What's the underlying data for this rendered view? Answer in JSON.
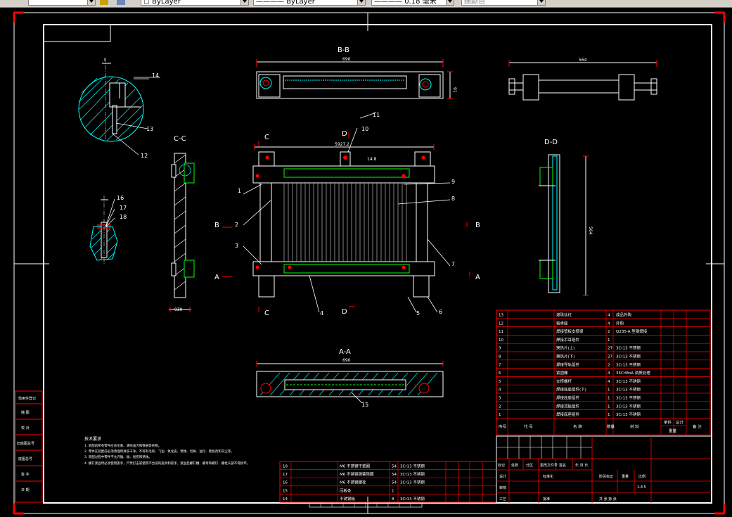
{
  "toolbar": {
    "linetype_value": "ByLayer",
    "lineweight_value": "ByLayer",
    "lineweight_size": "0.18 毫米",
    "plotstyle_value": "随颜色"
  },
  "drawing": {
    "section_labels": {
      "bb": "B-B",
      "cc": "C-C",
      "dd": "D-D",
      "aa": "A-A",
      "a": "A",
      "b": "B",
      "c": "C",
      "d": "D",
      "detail_one": "I"
    },
    "dimensions": {
      "bb_width": "690",
      "bb_height": "91",
      "top_right_width": "564",
      "main_width": "5927.2",
      "main_pitch": "14.8",
      "dd_height": "564",
      "aa_width": "690",
      "cc_width": "930"
    },
    "callouts": [
      "1",
      "2",
      "3",
      "4",
      "5",
      "6",
      "7",
      "8",
      "9",
      "10",
      "11",
      "12",
      "13",
      "14",
      "15",
      "16",
      "17",
      "18"
    ],
    "notes": [
      "技术要求",
      "1. 装配前所有零件应去毛刺、清除油污和铁屑等杂物。",
      "2. 零件在装配前必须清理和清洗干净，不得有毛刺、飞边、氧化皮、锈蚀、切屑、油污、着色剂和灰尘等。",
      "3. 装配过程中零件不允许磕、碰、划伤和锈蚀。",
      "4. 螺钉紧固时必须使用扳手，严禁打击或使用不合适的旋具和扳手，紧固后螺钉槽、螺母和螺钉、螺栓头部不得损坏。"
    ],
    "left_strip": [
      "借(通)用件登记",
      "旧底图总号",
      "底图总号",
      "签字",
      "日期"
    ],
    "left_strip_cells": [
      "借用件登记",
      "描 图",
      "校 对",
      "旧底图总号",
      "底图总号",
      "签 字",
      "日 期"
    ]
  },
  "bom": {
    "headers": [
      "序号",
      "代 号",
      "名 称",
      "数量",
      "材 料",
      "单件",
      "总计",
      "备 注"
    ],
    "weight_header": "重量",
    "rows": [
      [
        "13",
        "",
        "滚珠丝杠",
        "4",
        "成品外购"
      ],
      [
        "12",
        "",
        "轴承座",
        "4",
        "外购"
      ],
      [
        "11",
        "",
        "焊接管板支撑梁",
        "2",
        "Q235-A 型钢焊接"
      ],
      [
        "10",
        "",
        "焊接吊耳组件",
        "1",
        ""
      ],
      [
        "9",
        "",
        "换热片(上)",
        "27",
        "3Cr13 不锈钢"
      ],
      [
        "8",
        "",
        "换热片(下)",
        "27",
        "3Cr13 不锈钢"
      ],
      [
        "7",
        "",
        "焊接导轨组件",
        "2",
        "3Cr13 不锈钢"
      ],
      [
        "6",
        "",
        "紧固螺",
        "4",
        "35CrMoA 调质处理"
      ],
      [
        "5",
        "",
        "支撑螺杆",
        "4",
        "3Cr13 不锈钢"
      ],
      [
        "4",
        "",
        "焊接底座组件(下)",
        "1",
        "3Cr13 不锈钢"
      ],
      [
        "3",
        "",
        "焊接底座组件",
        "1",
        "3Cr13 不锈钢"
      ],
      [
        "2",
        "",
        "焊接顶板组件",
        "1",
        "3Cr13 不锈钢"
      ],
      [
        "1",
        "",
        "焊接底座组件",
        "1",
        "3Cr13 不锈钢"
      ]
    ],
    "lower_rows": [
      [
        "18",
        "M6 不锈钢平垫圈",
        "54",
        "3Cr13 不锈钢"
      ],
      [
        "17",
        "M6 不锈钢弹簧垫圈",
        "54",
        "3Cr13 不锈钢"
      ],
      [
        "16",
        "M6 不锈钢螺栓",
        "54",
        "3Cr13 不锈钢"
      ],
      [
        "15",
        "压板条",
        "1",
        ""
      ],
      [
        "14",
        "不锈钢板",
        "8",
        "3Cr13 不锈钢"
      ]
    ]
  },
  "title_block": {
    "change_row": [
      "标记",
      "处数",
      "分区",
      "更改文件号",
      "签名",
      "年.月.日"
    ],
    "design": "设计",
    "standardize": "标准化",
    "stage_mark": "阶段标记",
    "weight": "重量",
    "ratio": "比例",
    "ratio_value": "1:4.5",
    "review": "审核",
    "craft": "工艺",
    "approve": "批准",
    "sheet": "共  张  第  张"
  }
}
